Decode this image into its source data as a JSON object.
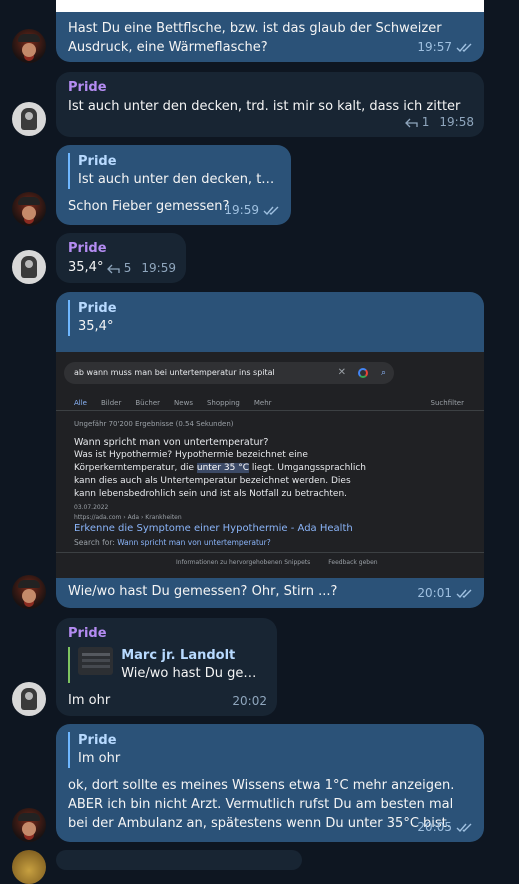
{
  "colors": {
    "background": "#0e1621",
    "incoming_bubble": "#182533",
    "outgoing_bubble": "#2b5278",
    "sender_name": "#b48cf2",
    "reply_sender_green": "#7ec461"
  },
  "messages": [
    {
      "text": "Hast Du eine Bettflsche, bzw. ist das glaub der Schweizer Ausdruck, eine Wärmeflasche?",
      "time": "19:57"
    },
    {
      "sender": "Pride",
      "text": "Ist auch unter den decken, trd. ist mir so kalt, dass ich zitter",
      "replies": "1",
      "time": "19:58"
    },
    {
      "quote_name": "Pride",
      "quote_text": "Ist auch unter den decken, trd. i...",
      "text": "Schon Fieber gemessen?",
      "time": "19:59"
    },
    {
      "sender": "Pride",
      "text": "35,4°",
      "replies": "5",
      "time": "19:59"
    },
    {
      "quote_name": "Pride",
      "quote_text": "35,4°",
      "screenshot": {
        "query": "ab wann muss man bei untertemperatur ins spital",
        "tabs": [
          "Alle",
          "Bilder",
          "Bücher",
          "News",
          "Shopping",
          "Mehr"
        ],
        "tools": "Suchfilter",
        "result_count": "Ungefähr 70'200 Ergebnisse (0.54 Sekunden)",
        "question": "Wann spricht man von untertemperatur?",
        "answer_before": "Was ist Hypothermie? Hypothermie bezeichnet eine Körperkerntemperatur, die ",
        "answer_highlight": "unter 35 °C",
        "answer_after": " liegt. Umgangssprachlich kann dies auch als Untertemperatur bezeichnet werden. Dies kann lebensbedrohlich sein und ist als Notfall zu betrachten.",
        "answer_date": "03.07.2022",
        "source": "https://ada.com › Ada › Krankheiten",
        "link_title": "Erkenne die Symptome einer Hypothermie - Ada Health",
        "search_for_label": "Search for:",
        "search_for_link": "Wann spricht man von untertemperatur?",
        "footer_info": "Informationen zu hervorgehobenen Snippets",
        "footer_feedback": "Feedback geben"
      },
      "text": "Wie/wo hast Du gemessen? Ohr, Stirn ...?",
      "time": "20:01"
    },
    {
      "sender": "Pride",
      "quote_name": "Marc jr. Landolt",
      "quote_text": "Wie/wo hast Du geme...",
      "text": "Im ohr",
      "time": "20:02"
    },
    {
      "quote_name": "Pride",
      "quote_text": "Im ohr",
      "text": "ok, dort sollte es meines Wissens etwa 1°C mehr anzeigen. ABER ich bin nicht Arzt. Vermutlich rufst Du am besten mal bei der Ambulanz an, spätestens wenn Du unter 35°C bist.",
      "time": "20:05"
    }
  ],
  "icons": {
    "read_receipt": "double-check-icon",
    "reply_count": "reply-arrow-icon",
    "search_clear": "close-icon",
    "search_lens": "google-lens-icon",
    "search_submit": "search-icon"
  }
}
